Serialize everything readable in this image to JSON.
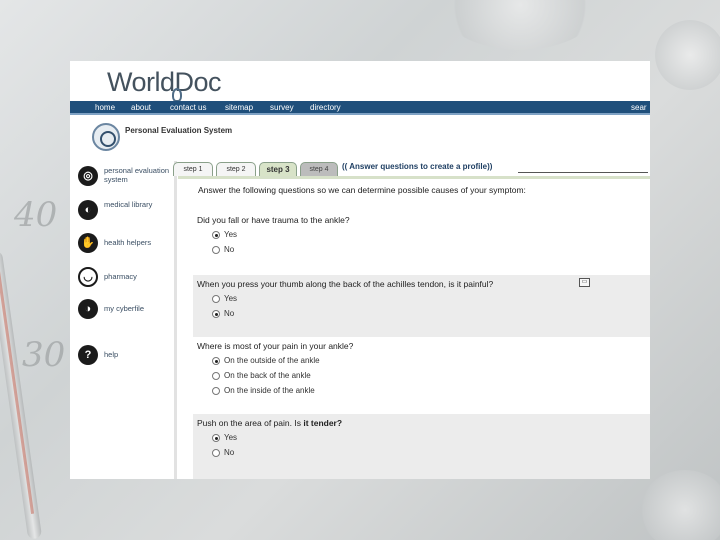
{
  "brand": {
    "logo": "WorldDoc"
  },
  "nav": {
    "items": [
      "home",
      "about",
      "contact us",
      "sitemap",
      "survey",
      "directory"
    ],
    "search": "sear"
  },
  "system_title": "Personal Evaluation System",
  "sidebar": {
    "items": [
      {
        "label": "personal evaluation system",
        "icon": "evaluation-icon"
      },
      {
        "label": "medical library",
        "icon": "library-icon"
      },
      {
        "label": "health helpers",
        "icon": "helpers-icon"
      },
      {
        "label": "pharmacy",
        "icon": "pharmacy-icon"
      },
      {
        "label": "my cyberfile",
        "icon": "cyberfile-icon"
      },
      {
        "label": "help",
        "icon": "help-icon"
      }
    ]
  },
  "tabs": [
    "step 1",
    "step 2",
    "step 3",
    "step 4"
  ],
  "active_tab": "step 3",
  "tab_hint": "(( Answer questions to create a profile))",
  "intro": "Answer the following questions so we can determine possible causes of your symptom:",
  "questions": [
    {
      "text": "Did you fall or have trauma to the ankle?",
      "options": [
        "Yes",
        "No"
      ],
      "selected": "Yes"
    },
    {
      "text": "When you press your thumb along the back of the achilles tendon, is it painful?",
      "options": [
        "Yes",
        "No"
      ],
      "selected": "No"
    },
    {
      "text": "Where is most of your pain in your ankle?",
      "options": [
        "On the outside of the ankle",
        "On the back of the ankle",
        "On the inside of the ankle"
      ],
      "selected": "On the outside of the ankle"
    },
    {
      "text_prefix": "Push on the area of pain. Is ",
      "text_bold": "it tender?",
      "options": [
        "Yes",
        "No"
      ],
      "selected": "Yes"
    }
  ],
  "background_numbers": [
    "40",
    "30"
  ]
}
